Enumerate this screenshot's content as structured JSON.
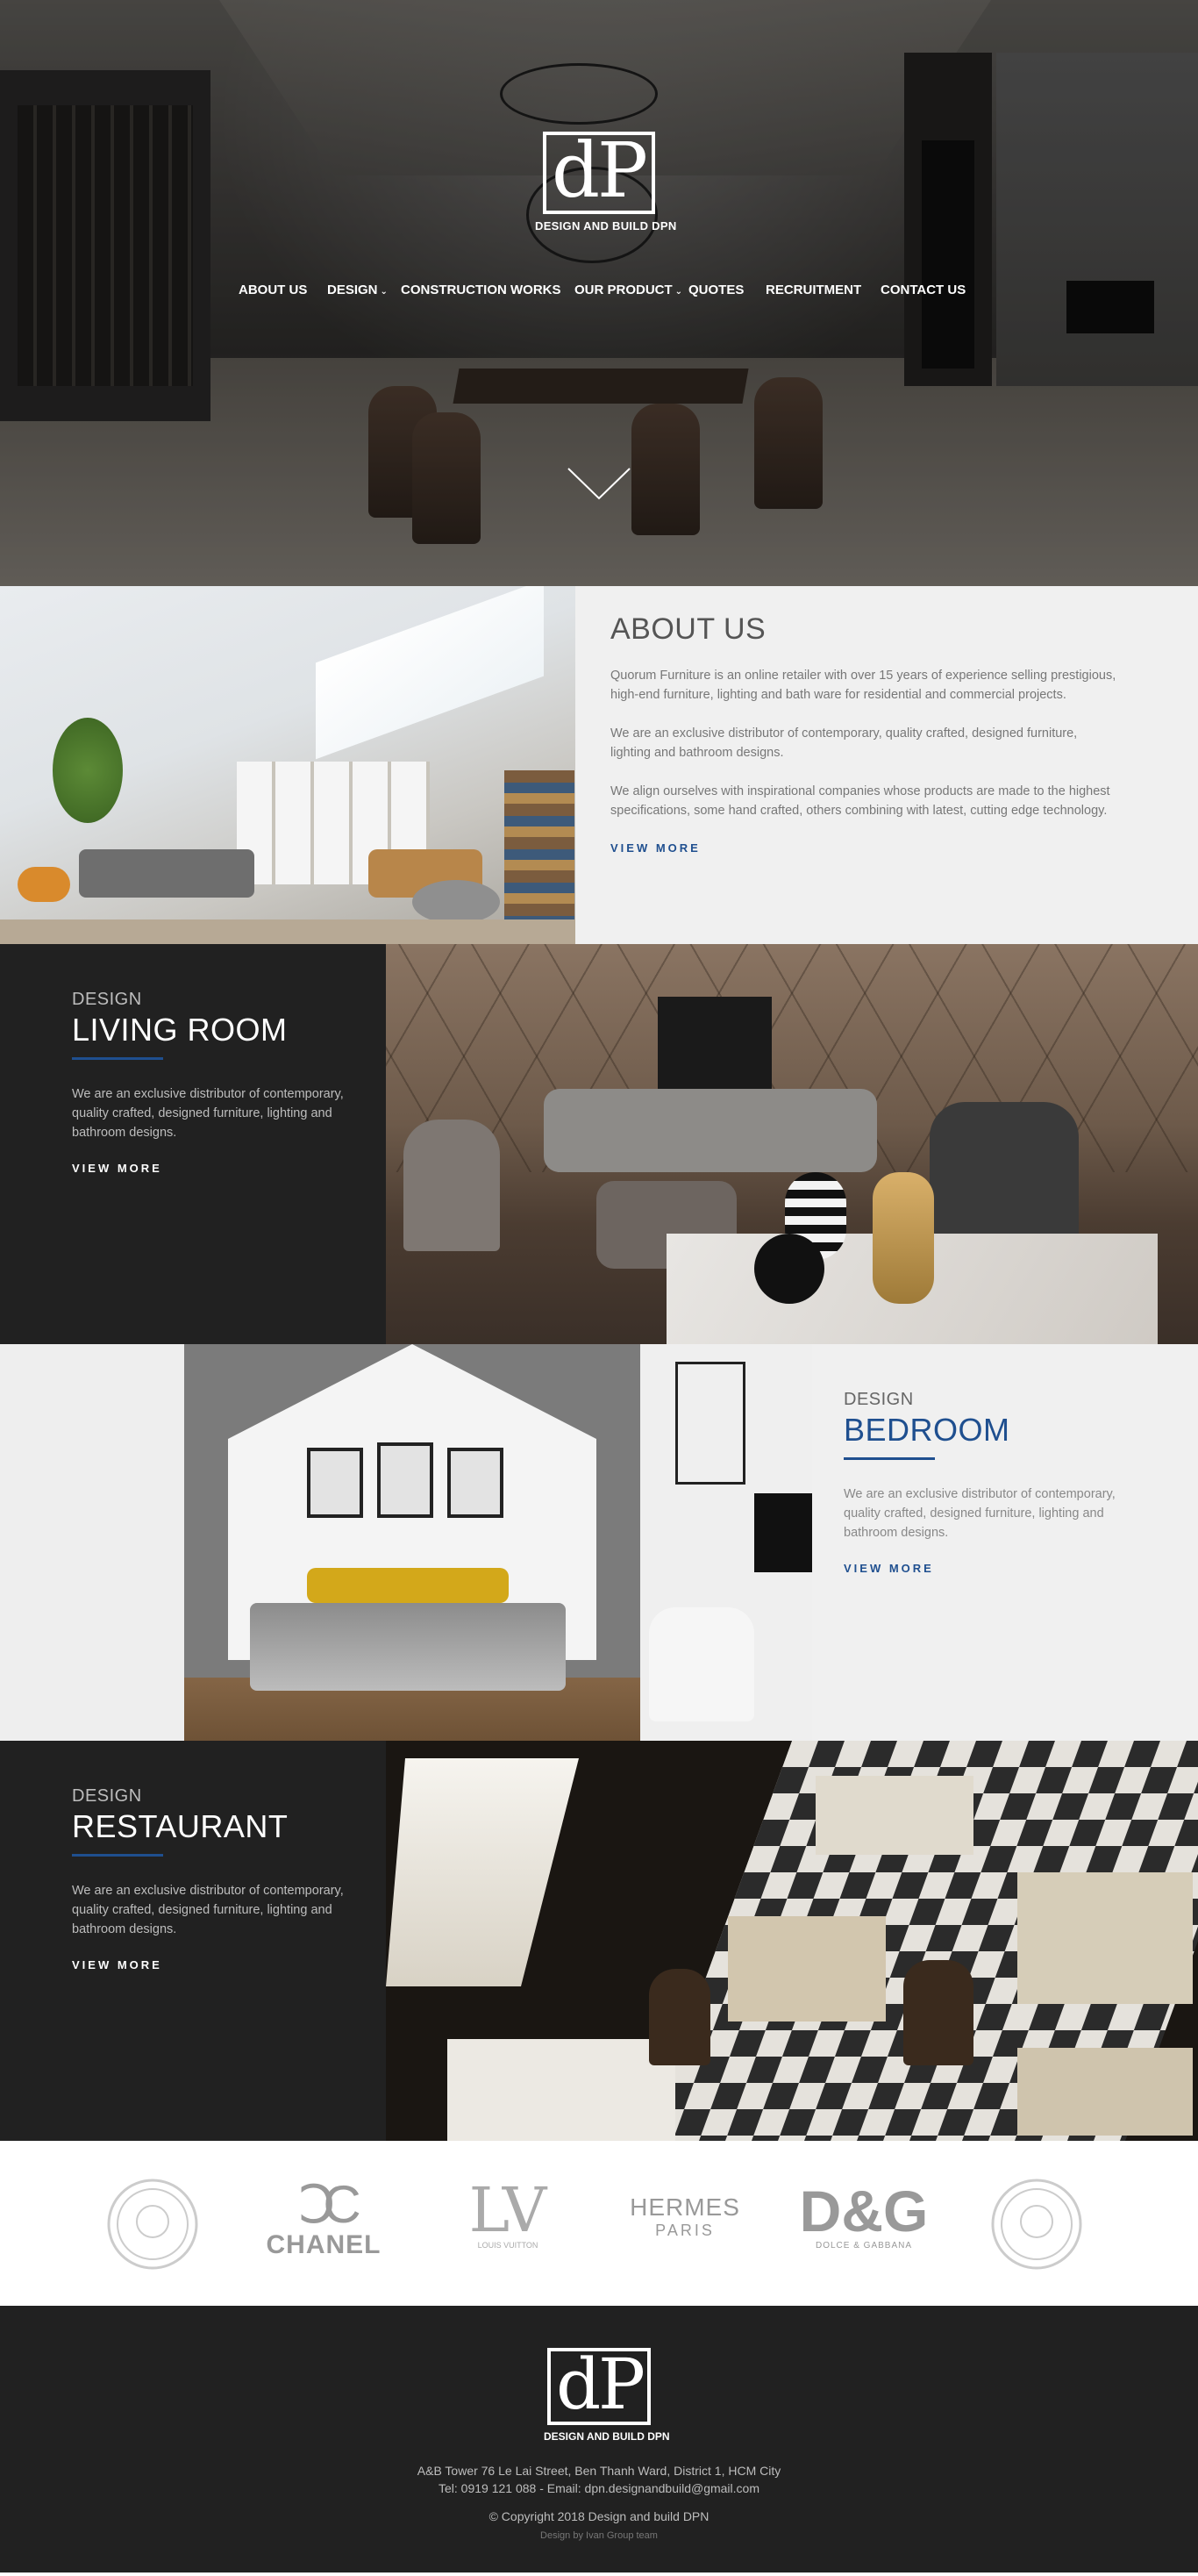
{
  "brand": {
    "logo_letters": "dP",
    "tagline": "DESIGN AND BUILD DPN"
  },
  "nav": {
    "items": [
      {
        "label": "ABOUT US",
        "dropdown": false
      },
      {
        "label": "DESIGN",
        "dropdown": true
      },
      {
        "label": "CONSTRUCTION WORKS",
        "dropdown": false
      },
      {
        "label": "OUR PRODUCT",
        "dropdown": true
      },
      {
        "label": "QUOTES",
        "dropdown": false
      },
      {
        "label": "RECRUITMENT",
        "dropdown": false
      },
      {
        "label": "CONTACT US",
        "dropdown": false
      }
    ],
    "scroll_icon": "chevron-down-icon"
  },
  "about": {
    "title": "ABOUT US",
    "paragraphs": [
      "Quorum Furniture is an online retailer with over 15 years of experience selling prestigious, high-end furniture, lighting and bath ware for residential and commercial projects.",
      "We are an exclusive distributor of contemporary, quality crafted, designed furniture, lighting and bathroom designs.",
      "We align ourselves with inspirational companies whose products are made to the highest specifications, some hand crafted, others combining with latest, cutting edge technology."
    ],
    "more": "VIEW MORE"
  },
  "sections": [
    {
      "eyebrow": "DESIGN",
      "title": "LIVING ROOM",
      "desc": "We are an exclusive distributor of contemporary, quality crafted, designed furniture, lighting and bathroom designs.",
      "more": "VIEW MORE"
    },
    {
      "eyebrow": "DESIGN",
      "title": "BEDROOM",
      "desc": "We are an exclusive distributor of contemporary, quality crafted, designed furniture, lighting and bathroom designs.",
      "more": "VIEW MORE"
    },
    {
      "eyebrow": "DESIGN",
      "title": "RESTAURANT",
      "desc": "We are an exclusive distributor of contemporary, quality crafted, designed furniture, lighting and bathroom designs.",
      "more": "VIEW MORE"
    }
  ],
  "brands": [
    "CHANEL",
    "HERMES",
    "PARIS",
    "D&G",
    "DOLCE & GABBANA",
    "LOUIS VUITTON"
  ],
  "footer": {
    "address": "A&B Tower 76 Le Lai Street, Ben Thanh Ward, District 1, HCM City",
    "contact": "Tel: 0919 121 088  -  Email: dpn.designandbuild@gmail.com",
    "copyright": "© Copyright 2018 Design and build DPN",
    "credit": "Design by Ivan Group team"
  },
  "colors": {
    "accent": "#1f4f8f",
    "dark": "#212121",
    "light": "#f0f0f0"
  }
}
